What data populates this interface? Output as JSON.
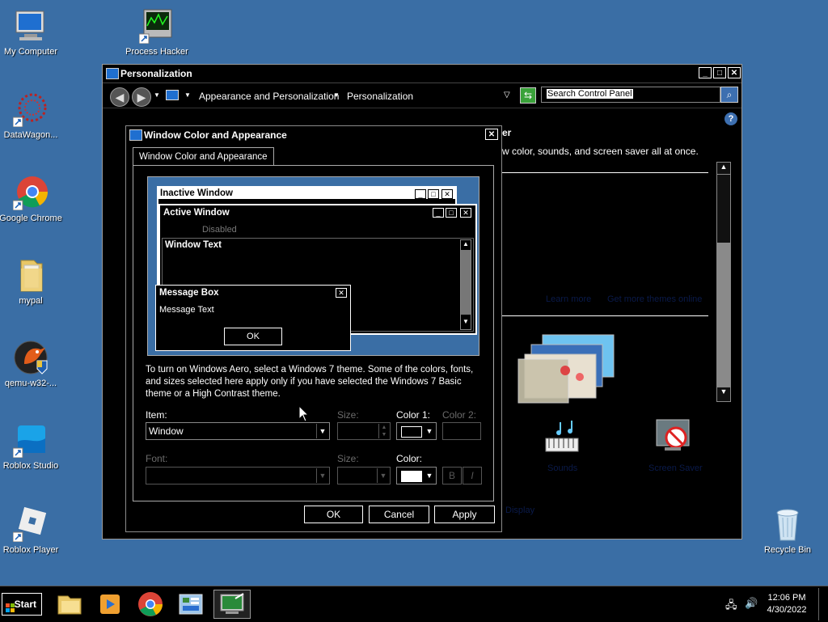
{
  "desktop": {
    "icons": [
      {
        "label": "My Computer",
        "icon": "computer-icon"
      },
      {
        "label": "Process Hacker\n2",
        "icon": "process-hacker-icon"
      },
      {
        "label": "DataWagon...",
        "icon": "datawagon-icon"
      },
      {
        "label": "Google Chrome",
        "icon": "chrome-icon"
      },
      {
        "label": "mypal",
        "icon": "folder-icon"
      },
      {
        "label": "qemu-w32-...",
        "icon": "qemu-icon"
      },
      {
        "label": "Roblox Studio",
        "icon": "roblox-studio-icon"
      },
      {
        "label": "Roblox Player",
        "icon": "roblox-player-icon"
      },
      {
        "label": "Recycle Bin",
        "icon": "recycle-bin-icon"
      }
    ]
  },
  "personalization": {
    "title": "Personalization",
    "breadcrumb": [
      "Appearance and Personalization",
      "Personalization"
    ],
    "search_placeholder": "Search Control Panel",
    "heading_fragment": "er",
    "description_fragment": "w color, sounds, and screen saver all at once.",
    "faint_links": [
      "Learn more",
      "Get more themes online",
      "Sounds",
      "Screen Saver",
      "Display"
    ]
  },
  "dialog": {
    "title": "Window Color and Appearance",
    "tab_label": "Window Color and Appearance",
    "preview": {
      "inactive_title": "Inactive Window",
      "active_title": "Active Window",
      "disabled_label": "Disabled",
      "window_text_label": "Window Text",
      "message_box_title": "Message Box",
      "message_text": "Message Text",
      "ok_label": "OK"
    },
    "info_text": "To turn on Windows Aero, select a Windows 7 theme.  Some of the colors, fonts, and sizes selected here apply only if you have selected the Windows 7 Basic theme or a High Contrast theme.",
    "item_label": "Item:",
    "item_value": "Window",
    "size_label": "Size:",
    "color1_label": "Color 1:",
    "color2_label": "Color 2:",
    "font_label": "Font:",
    "font_size_label": "Size:",
    "color_label": "Color:",
    "bold_label": "B",
    "italic_label": "I",
    "ok_button": "OK",
    "cancel_button": "Cancel",
    "apply_button": "Apply",
    "color1_swatch": "#000000",
    "font_color_swatch": "#ffffff"
  },
  "taskbar": {
    "start_label": "Start",
    "time": "12:06 PM",
    "date": "4/30/2022",
    "apps": [
      "file-explorer-icon",
      "media-player-icon",
      "chrome-icon",
      "control-panel-icon",
      "personalization-icon"
    ]
  }
}
